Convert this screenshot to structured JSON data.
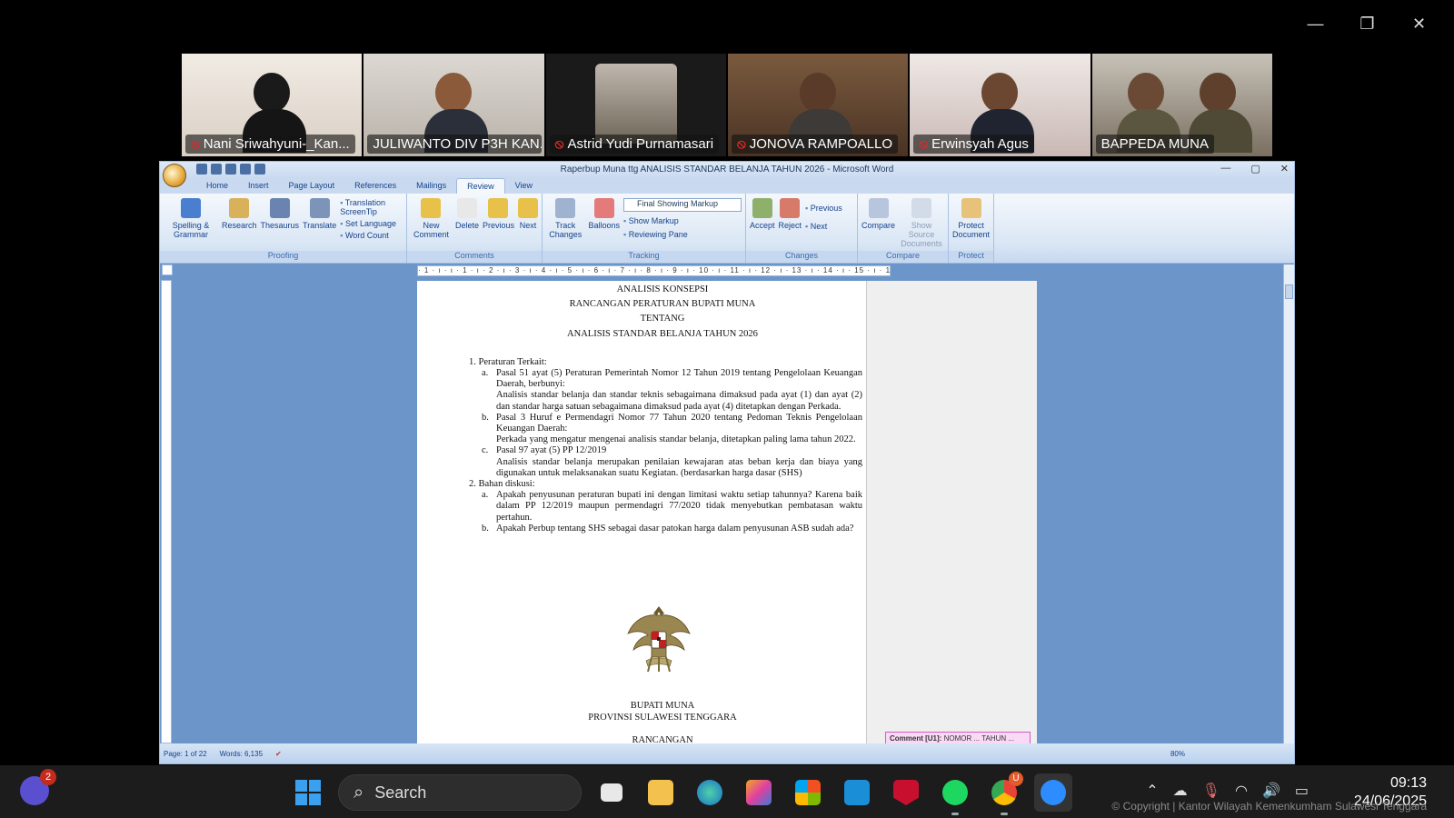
{
  "zoom_window": {
    "minimize": "—",
    "restore": "❐",
    "close": "✕"
  },
  "participants": [
    {
      "name": "Nani Sriwahyuni-_Kan...",
      "muted": true,
      "active": false
    },
    {
      "name": "JULIWANTO DIV P3H KAN...",
      "muted": false,
      "active": true
    },
    {
      "name": "Astrid Yudi Purnamasari",
      "muted": true,
      "active": false
    },
    {
      "name": "JONOVA RAMPOALLO",
      "muted": true,
      "active": false
    },
    {
      "name": "Erwinsyah Agus",
      "muted": true,
      "active": false
    },
    {
      "name": "BAPPEDA MUNA",
      "muted": false,
      "active": false
    }
  ],
  "word": {
    "title": "Raperbup Muna ttg ANALISIS STANDAR BELANJA TAHUN 2026 - Microsoft Word",
    "controls": {
      "minimize": "—",
      "restore": "▢",
      "close": "✕"
    },
    "tabs": [
      "Home",
      "Insert",
      "Page Layout",
      "References",
      "Mailings",
      "Review",
      "View"
    ],
    "selected_tab": "Review",
    "ribbon": {
      "proofing": {
        "label": "Proofing",
        "spelling": "Spelling & Grammar",
        "research": "Research",
        "thesaurus": "Thesaurus",
        "translate": "Translate",
        "screentip": "Translation ScreenTip",
        "set_language": "Set Language",
        "word_count": "Word Count"
      },
      "comments": {
        "label": "Comments",
        "new": "New Comment",
        "delete": "Delete",
        "previous": "Previous",
        "next": "Next"
      },
      "tracking": {
        "label": "Tracking",
        "track": "Track Changes",
        "balloons": "Balloons",
        "display": "Final Showing Markup",
        "show_markup": "Show Markup",
        "reviewing_pane": "Reviewing Pane"
      },
      "changes": {
        "label": "Changes",
        "accept": "Accept",
        "reject": "Reject",
        "previous": "Previous",
        "next": "Next"
      },
      "compare": {
        "label": "Compare",
        "compare": "Compare",
        "show_source": "Show Source Documents"
      },
      "protect": {
        "label": "Protect",
        "protect": "Protect Document"
      }
    },
    "ruler_text": "· 1 · ı · ı · 1 · ı · 2 · ı · 3 · ı · 4 · ı · 5 · ı · 6 · ı · 7 · ı · 8 · ı · 9 · ı · 10 · ı · 11 · ı · 12 · ı · 13 · ı · 14 · ı · 15 · ı · 16 · ı · 17 · ı · 18 · 19 ·",
    "document": {
      "heading": [
        "ANALISIS KONSEPSI",
        "RANCANGAN PERATURAN BUPATI MUNA",
        "TENTANG",
        "ANALISIS STANDAR BELANJA TAHUN 2026"
      ],
      "item1": "1. Peraturan Terkait:",
      "a_label": "a.",
      "a_title": "Pasal 51 ayat (5) Peraturan Pemerintah Nomor 12 Tahun 2019 tentang Pengelolaan Keuangan Daerah, berbunyi:",
      "a_body": "Analisis standar belanja dan standar teknis sebagaimana dimaksud pada ayat (1) dan ayat (2) dan standar harga satuan sebagaimana dimaksud pada ayat (4) ditetapkan dengan Perkada.",
      "b_label": "b.",
      "b_title": "Pasal 3 Huruf e Permendagri Nomor 77 Tahun 2020 tentang Pedoman Teknis Pengelolaan Keuangan Daerah:",
      "b_body": "Perkada yang mengatur mengenai analisis standar belanja, ditetapkan paling lama tahun 2022.",
      "c_label": "c.",
      "c_title": "Pasal 97 ayat (5) PP 12/2019",
      "c_body": "Analisis standar belanja merupakan penilaian kewajaran atas beban kerja dan biaya yang digunakan untuk melaksanakan suatu Kegiatan. (berdasarkan harga dasar (SHS)",
      "item2": "2. Bahan diskusi:",
      "d_label": "a.",
      "d_body": "Apakah penyusunan peraturan bupati ini dengan limitasi waktu setiap tahunnya? Karena baik dalam PP 12/2019 maupun permendagri 77/2020 tidak menyebutkan pembatasan waktu pertahun.",
      "e_label": "b.",
      "e_body": "Apakah Perbup tentang SHS sebagai dasar patokan harga dalam penyusunan ASB sudah ada?",
      "footer": [
        "BUPATI MUNA",
        "PROVINSI SULAWESI TENGGARA",
        "RANCANGAN"
      ]
    },
    "comment": {
      "label": "Comment [U1]:",
      "text": "NOMOR ... TAHUN ..."
    },
    "status": {
      "page": "Page: 1 of 22",
      "words": "Words: 6,135",
      "zoom": "80%"
    }
  },
  "taskbar": {
    "teams_badge": "2",
    "search_placeholder": "Search",
    "chrome_badge": "U",
    "time": "09:13",
    "date": "24/06/2025",
    "copyright": "© Copyright | Kantor Wilayah Kemenkumham Sulawesi Tenggara"
  }
}
